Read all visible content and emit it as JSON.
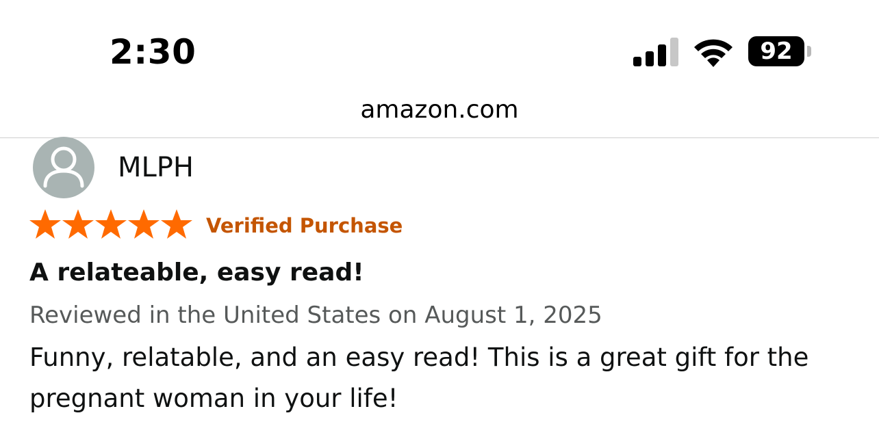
{
  "status_bar": {
    "time": "2:30",
    "battery_level": "92",
    "battery_percent": 92,
    "signal_bars_total": 4,
    "signal_bars_active": 3,
    "icons": [
      "signal-icon",
      "wifi-icon",
      "battery-icon"
    ]
  },
  "browser": {
    "url": "amazon.com"
  },
  "review": {
    "reviewer_name": "MLPH",
    "rating": 5,
    "rating_max": 5,
    "verified_label": "Verified Purchase",
    "title": "A relateable, easy read!",
    "meta": "Reviewed in the United States on August 1, 2025",
    "body": "Funny, relatable, and an easy read! This is a great gift for the pregnant woman in your life!"
  },
  "colors": {
    "star": "#ff6a00",
    "verified": "#c45500",
    "meta_text": "#565959",
    "avatar_bg": "#a9b4b3"
  }
}
